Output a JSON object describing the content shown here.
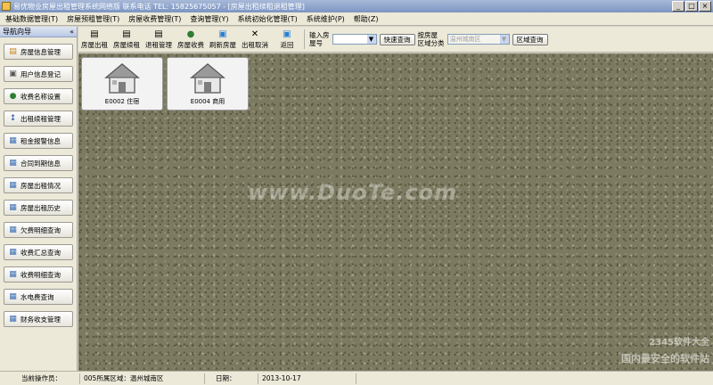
{
  "window": {
    "title": "易优物业房屋出租管理系统网络版 联系电话 TEL: 15825675057 - [房屋出租续租退租管理]",
    "buttons": {
      "minimize": "_",
      "maximize": "□",
      "close": "×"
    }
  },
  "menu": [
    "基础数据管理(T)",
    "房屋预租管理(T)",
    "房屋收费管理(T)",
    "查询管理(Y)",
    "系统初始化管理(T)",
    "系统维护(P)",
    "帮助(Z)"
  ],
  "nav": {
    "header": "导航向导",
    "collapse": "«",
    "items": [
      {
        "label": "房屋信息管理",
        "icon": "building-icon"
      },
      {
        "label": "用户信息登记",
        "icon": "user-card-icon"
      },
      {
        "label": "收费名称设置",
        "icon": "money-bag-icon"
      },
      {
        "label": "出租续租管理",
        "icon": "lease-icon"
      },
      {
        "label": "租金报警信息",
        "icon": "alarm-icon"
      },
      {
        "label": "合同到期信息",
        "icon": "contract-icon"
      },
      {
        "label": "房屋出租情况",
        "icon": "house-status-icon"
      },
      {
        "label": "房屋出租历史",
        "icon": "history-icon"
      },
      {
        "label": "欠费明细查询",
        "icon": "arrears-icon"
      },
      {
        "label": "收费汇总查询",
        "icon": "summary-icon"
      },
      {
        "label": "收费明细查询",
        "icon": "detail-icon"
      },
      {
        "label": "水电费查询",
        "icon": "utility-icon"
      },
      {
        "label": "财务收支管理",
        "icon": "finance-icon"
      }
    ]
  },
  "toolbar": {
    "buttons": [
      {
        "label": "房屋出租",
        "icon": "rent-icon"
      },
      {
        "label": "房屋续租",
        "icon": "renew-icon"
      },
      {
        "label": "退租管理",
        "icon": "checkout-icon"
      },
      {
        "label": "房屋收费",
        "icon": "charge-icon"
      },
      {
        "label": "刷新房屋",
        "icon": "refresh-icon"
      },
      {
        "label": "出租取消",
        "icon": "cancel-icon"
      },
      {
        "label": "返回",
        "icon": "back-icon"
      }
    ],
    "room_label_line1": "输入房",
    "room_label_line2": "屋号",
    "quick_query": "快速查询",
    "area_label_line1": "按房屋",
    "area_label_line2": "区域分类",
    "area_value": "温州城南区",
    "area_query": "区域查询"
  },
  "rooms": [
    {
      "label": "E0002 住宿"
    },
    {
      "label": "E0004 商用"
    }
  ],
  "watermark": {
    "text": "www.DuoTe.com",
    "logo_line1": "2345软件大全",
    "logo_line2": "国内最安全的软件站"
  },
  "status": {
    "operator": "当前操作员：",
    "area": "005所属区域：温州城南区",
    "date_label": "日期：",
    "date_value": "2013-10-17"
  },
  "colors": {
    "workspace": "#7c7a60",
    "titlebar": "#7b95c2"
  }
}
